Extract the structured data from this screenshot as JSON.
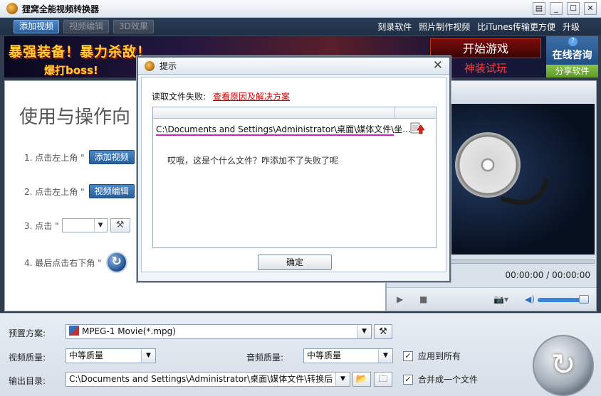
{
  "window": {
    "title": "狸窝全能视频转换器",
    "controls": [
      "▤",
      "_",
      "☐",
      "✕"
    ]
  },
  "toolbar": {
    "add_video": "添加视频",
    "video_edit": "视频编辑",
    "effect_3d": "3D效果",
    "links": [
      "刻录软件",
      "照片制作视频",
      "比iTunes传输更方便",
      "升级"
    ]
  },
  "banner": {
    "text1": "暴强装备！暴力杀敌！",
    "text2": "爆打boss!",
    "start_game": "开始游戏",
    "try_gear": "神装试玩",
    "online_consult": "在线咨询",
    "help": "?",
    "share": "分享软件"
  },
  "guide": {
    "title": "使用与操作向",
    "step1": "1. 点击左上角 \"",
    "step1_btn": "添加视频",
    "step2": "2. 点击左上角 \"",
    "step2_btn": "视频编辑",
    "step3": "3. 点击 \"",
    "step4": "4. 最后点击右下角 \""
  },
  "preview": {
    "time": "00:00:00 / 00:00:00"
  },
  "settings": {
    "preset_label": "预置方案:",
    "preset_value": "MPEG-1 Movie(*.mpg)",
    "video_quality_label": "视频质量:",
    "video_quality_value": "中等质量",
    "audio_quality_label": "音频质量:",
    "audio_quality_value": "中等质量",
    "apply_all_label": "应用到所有",
    "output_dir_label": "输出目录:",
    "output_dir_value": "C:\\Documents and Settings\\Administrator\\桌面\\媒体文件\\转换后",
    "merge_label": "合并成一个文件"
  },
  "dialog": {
    "title": "提示",
    "close": "✕",
    "error_label": "读取文件失败:",
    "error_link": "查看原因及解决方案",
    "file_path": "C:\\Documents and Settings\\Administrator\\桌面\\媒体文件\\坐...",
    "message": "哎哦，这是个什么文件？咋添加不了失败了呢",
    "ok_button": "确定"
  }
}
